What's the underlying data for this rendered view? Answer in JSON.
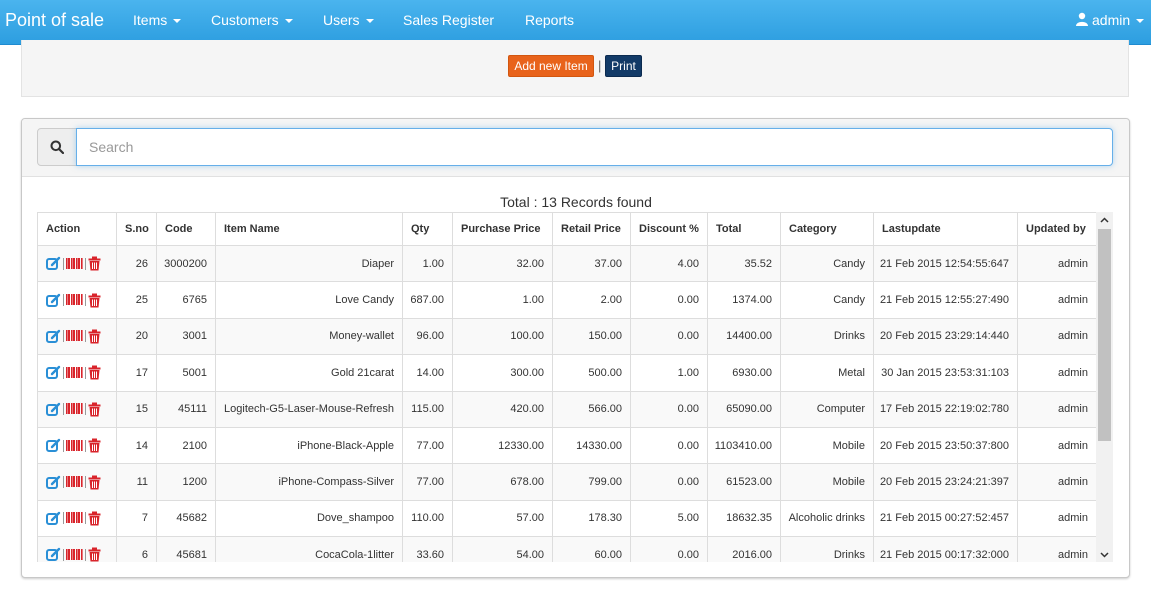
{
  "navbar": {
    "brand": "Point of sale",
    "items": [
      {
        "label": "Items",
        "dropdown": true
      },
      {
        "label": "Customers",
        "dropdown": true
      },
      {
        "label": "Users",
        "dropdown": true
      },
      {
        "label": "Sales Register",
        "dropdown": false
      },
      {
        "label": "Reports",
        "dropdown": false
      }
    ],
    "user": "admin"
  },
  "toolbar": {
    "add_label": "Add new Item",
    "separator": "|",
    "print_label": "Print"
  },
  "search": {
    "placeholder": "Search"
  },
  "summary": "Total : 13 Records found",
  "table": {
    "columns": [
      "Action",
      "S.no",
      "Code",
      "Item Name",
      "Qty",
      "Purchase Price",
      "Retail Price",
      "Discount %",
      "Total",
      "Category",
      "Lastupdate",
      "Updated by"
    ],
    "rows": [
      [
        "26",
        "3000200",
        "Diaper",
        "1.00",
        "32.00",
        "37.00",
        "4.00",
        "35.52",
        "Candy",
        "21 Feb 2015 12:54:55:647",
        "admin"
      ],
      [
        "25",
        "6765",
        "Love Candy",
        "687.00",
        "1.00",
        "2.00",
        "0.00",
        "1374.00",
        "Candy",
        "21 Feb 2015 12:55:27:490",
        "admin"
      ],
      [
        "20",
        "3001",
        "Money-wallet",
        "96.00",
        "100.00",
        "150.00",
        "0.00",
        "14400.00",
        "Drinks",
        "20 Feb 2015 23:29:14:440",
        "admin"
      ],
      [
        "17",
        "5001",
        "Gold 21carat",
        "14.00",
        "300.00",
        "500.00",
        "1.00",
        "6930.00",
        "Metal",
        "30 Jan 2015 23:53:31:103",
        "admin"
      ],
      [
        "15",
        "45111",
        "Logitech-G5-Laser-Mouse-Refresh",
        "115.00",
        "420.00",
        "566.00",
        "0.00",
        "65090.00",
        "Computer",
        "17 Feb 2015 22:19:02:780",
        "admin"
      ],
      [
        "14",
        "2100",
        "iPhone-Black-Apple",
        "77.00",
        "12330.00",
        "14330.00",
        "0.00",
        "1103410.00",
        "Mobile",
        "20 Feb 2015 23:50:37:800",
        "admin"
      ],
      [
        "11",
        "1200",
        "iPhone-Compass-Silver",
        "77.00",
        "678.00",
        "799.00",
        "0.00",
        "61523.00",
        "Mobile",
        "20 Feb 2015 23:24:21:397",
        "admin"
      ],
      [
        "7",
        "45682",
        "Dove_shampoo",
        "110.00",
        "57.00",
        "178.30",
        "5.00",
        "18632.35",
        "Alcoholic drinks",
        "21 Feb 2015 00:27:52:457",
        "admin"
      ],
      [
        "6",
        "45681",
        "CocaCola-1litter",
        "33.60",
        "54.00",
        "60.00",
        "0.00",
        "2016.00",
        "Drinks",
        "21 Feb 2015 00:17:32:000",
        "admin"
      ]
    ]
  },
  "colors": {
    "navbar": "#2d9ee0",
    "add_button": "#e8631b",
    "print_button": "#123a67",
    "edit_icon": "#2a8fd6",
    "delete_icon": "#d9242b"
  },
  "icons": {
    "edit": "edit-icon",
    "barcode": "barcode-icon",
    "delete": "trash-icon",
    "search": "search-icon",
    "user": "user-icon"
  }
}
